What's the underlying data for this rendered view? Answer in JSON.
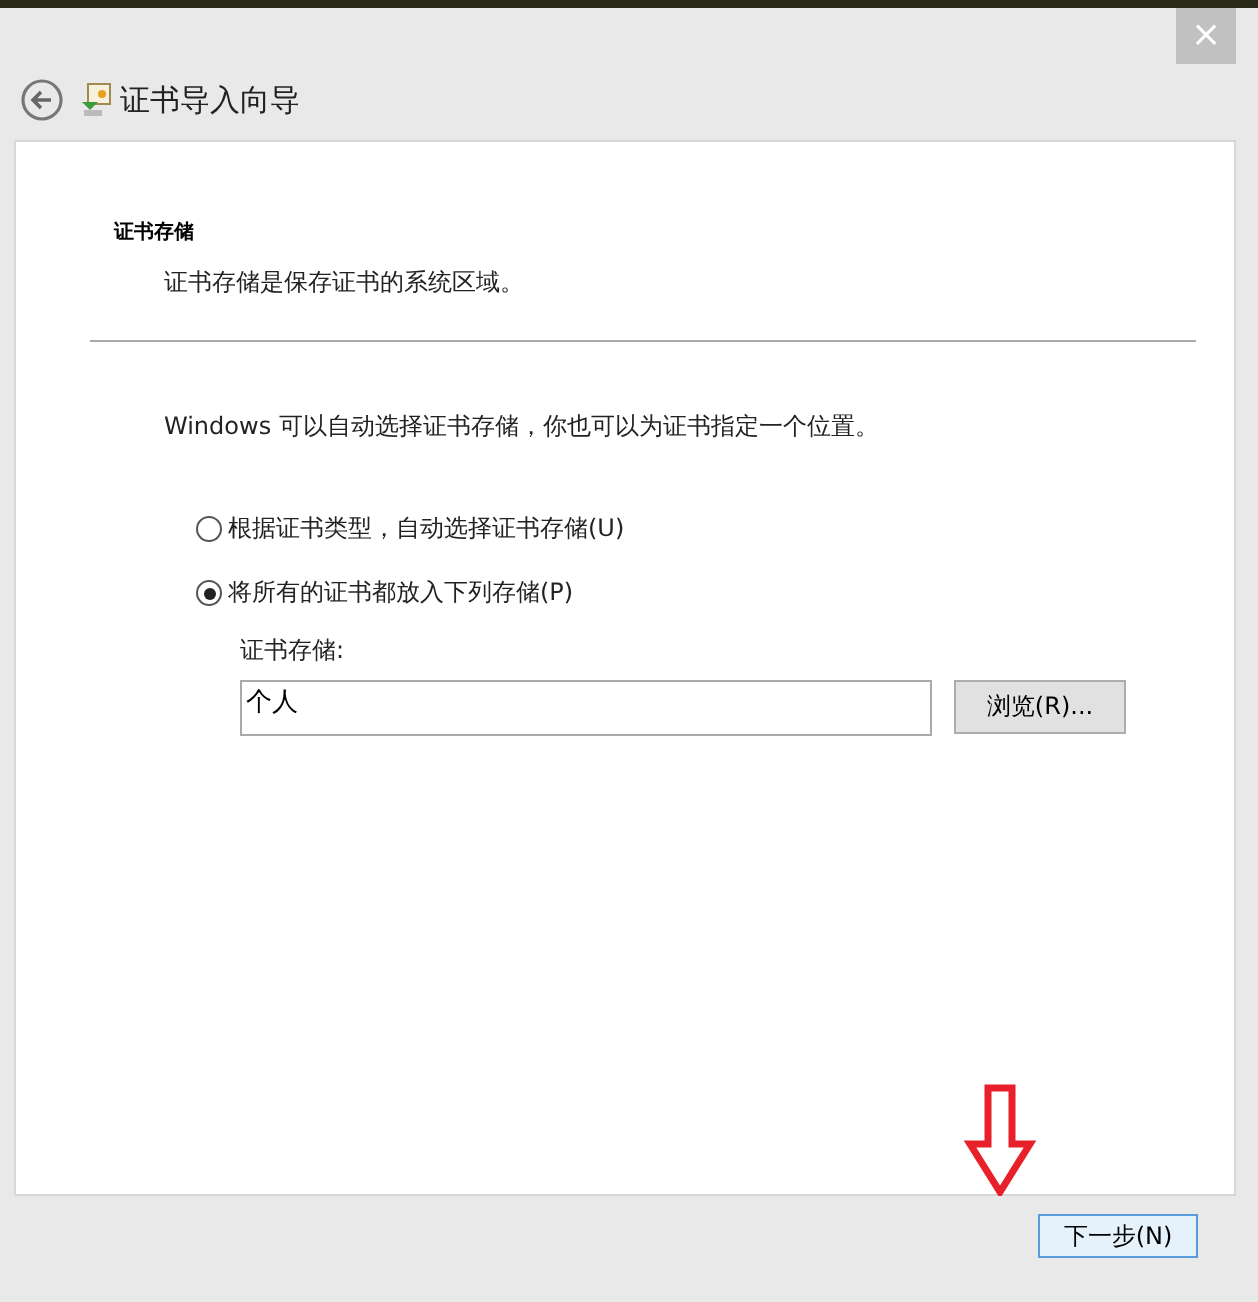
{
  "window": {
    "title": "证书导入向导",
    "close": "×"
  },
  "section": {
    "heading": "证书存储",
    "description": "证书存储是保存证书的系统区域。"
  },
  "intro": "Windows 可以自动选择证书存储，你也可以为证书指定一个位置。",
  "options": [
    {
      "label": "根据证书类型，自动选择证书存储(U)",
      "selected": false
    },
    {
      "label": "将所有的证书都放入下列存储(P)",
      "selected": true
    }
  ],
  "store": {
    "label": "证书存储:",
    "value": "个人",
    "browse": "浏览(R)..."
  },
  "buttons": [
    "下一步(N)"
  ]
}
